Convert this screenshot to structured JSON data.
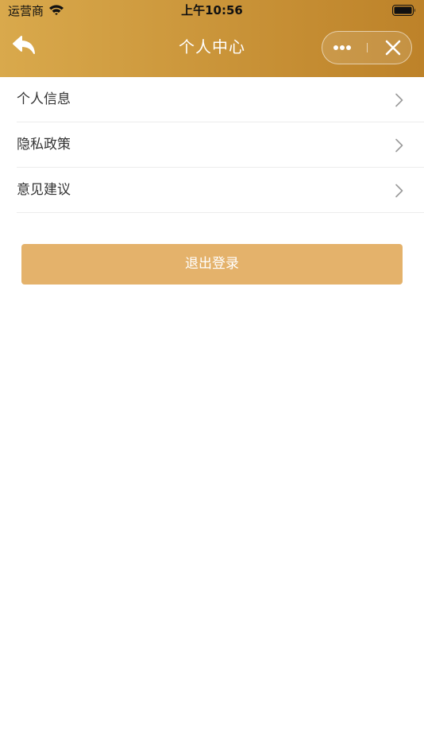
{
  "status_bar": {
    "carrier": "运营商",
    "time": "上午10:56"
  },
  "nav": {
    "title": "个人中心",
    "back_icon": "reply-arrow-icon",
    "more_icon": "more-dots-icon",
    "close_icon": "close-icon"
  },
  "menu": {
    "items": [
      {
        "label": "个人信息"
      },
      {
        "label": "隐私政策"
      },
      {
        "label": "意见建议"
      }
    ]
  },
  "logout": {
    "label": "退出登录"
  },
  "colors": {
    "header_start": "#d9a94c",
    "header_end": "#bd8229",
    "button_bg": "#e4b26b",
    "text": "#333333"
  }
}
